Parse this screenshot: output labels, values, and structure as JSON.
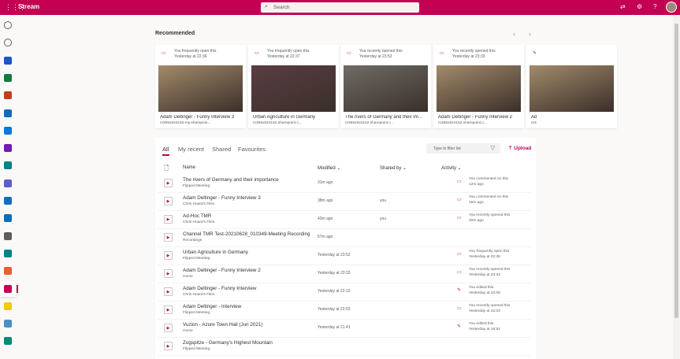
{
  "header": {
    "app": "Stream",
    "search_placeholder": "Search",
    "icons": [
      "waffle-icon",
      "whats-new-icon",
      "settings-icon",
      "help-icon",
      "avatar"
    ]
  },
  "colors": {
    "brand": "#c30052"
  },
  "sidebar": {
    "items": [
      {
        "name": "home",
        "color": "#605e5c"
      },
      {
        "name": "create",
        "color": "#605e5c"
      },
      {
        "name": "word",
        "color": "#185abd"
      },
      {
        "name": "excel",
        "color": "#107c41"
      },
      {
        "name": "powerpoint",
        "color": "#c43e1c"
      },
      {
        "name": "outlook",
        "color": "#0f6cbd"
      },
      {
        "name": "onedrive",
        "color": "#0f78d4"
      },
      {
        "name": "onenote",
        "color": "#7719aa"
      },
      {
        "name": "sharepoint",
        "color": "#038387"
      },
      {
        "name": "teams",
        "color": "#5b5fc7"
      },
      {
        "name": "yammer",
        "color": "#106ebe"
      },
      {
        "name": "power-automate",
        "color": "#0f6cbd"
      },
      {
        "name": "exchange",
        "color": "#605e5c"
      },
      {
        "name": "sway",
        "color": "#038387"
      },
      {
        "name": "forms-orange",
        "color": "#e8602b"
      },
      {
        "name": "stream",
        "color": "#c30052"
      },
      {
        "name": "power-bi",
        "color": "#f2c811"
      },
      {
        "name": "kaizala",
        "color": "#4a90c2"
      },
      {
        "name": "bookings",
        "color": "#0a8a76"
      }
    ]
  },
  "recommended": {
    "title": "Recommended",
    "cards": [
      {
        "activity": "You frequently open this",
        "time": "Yesterday at 22:36",
        "title": "Adam Deltinger - Funny Interview 3",
        "url": "m365x924162-my.sharepoin...",
        "thumb": "#a38a6a"
      },
      {
        "activity": "You frequently open this",
        "time": "Yesterday at 22:37",
        "title": "Urban Agriculture in Germany",
        "url": "m365x924162.sharepoint.c...",
        "thumb": "#5a3d42"
      },
      {
        "activity": "You recently opened this",
        "time": "Yesterday at 23:53",
        "title": "The rivers of Germany and their im...",
        "url": "m365x924162.sharepoint.c...",
        "thumb": "#6f6c66"
      },
      {
        "activity": "You recently opened this",
        "time": "Yesterday at 23:33",
        "title": "Adam Deltinger - Funny Interview 2",
        "url": "m365x924162.sharepoint.c...",
        "thumb": "#a38a6a"
      },
      {
        "activity": "",
        "time": "",
        "title": "Ad",
        "url": "m3",
        "thumb": "#a38a6a"
      }
    ]
  },
  "list": {
    "tabs": [
      "All",
      "My recent",
      "Shared",
      "Favourites"
    ],
    "filter_placeholder": "Type to filter list",
    "upload": "Upload",
    "columns": {
      "name": "Name",
      "modified": "Modified",
      "shared": "Shared by",
      "activity": "Activity"
    },
    "rows": [
      {
        "name": "The rivers of Germany and their importance",
        "loc": "Flipped Meeting",
        "modified": "31m ago",
        "shared": "",
        "icon": "comment-icon",
        "a1": "You commented on this",
        "a2": "12m ago"
      },
      {
        "name": "Adam Deltinger - Funny Interview 3",
        "loc": "Chris Hoard's Files",
        "modified": "38m ago",
        "shared": "you",
        "icon": "comment-icon",
        "a1": "You commented on this",
        "a2": "15m ago"
      },
      {
        "name": "Ad-Hoc TMR",
        "loc": "Chris Hoard's Files",
        "modified": "43m ago",
        "shared": "you",
        "icon": "opened-icon",
        "a1": "You recently opened this",
        "a2": "20m ago"
      },
      {
        "name": "Channel TMR Test-20210628_010349-Meeting Recording",
        "loc": "Recordings",
        "modified": "57m ago",
        "shared": "",
        "icon": "",
        "a1": "",
        "a2": ""
      },
      {
        "name": "Urban Agriculture in Germany",
        "loc": "Flipped Meeting",
        "modified": "Yesterday at 23:52",
        "shared": "",
        "icon": "opened-icon",
        "a1": "You frequently open this",
        "a2": "Yesterday at 22:36"
      },
      {
        "name": "Adam Deltinger - Funny Interview 2",
        "loc": "Home",
        "modified": "Yesterday at 23:33",
        "shared": "",
        "icon": "opened-icon",
        "a1": "You recently opened this",
        "a2": "Yesterday at 23:33"
      },
      {
        "name": "Adam Deltinger - Funny Interview",
        "loc": "Chris Hoard's Files",
        "modified": "Yesterday at 22:10",
        "shared": "",
        "icon": "edit-icon",
        "a1": "You edited this",
        "a2": "Yesterday at 22:09"
      },
      {
        "name": "Adam Deltinger - Interview",
        "loc": "Flipped Meeting",
        "modified": "Yesterday at 22:03",
        "shared": "",
        "icon": "opened-icon",
        "a1": "You recently opened this",
        "a2": "Yesterday at 22:03"
      },
      {
        "name": "Vuzion - Azure Town Hall (Jun 2021)",
        "loc": "Home",
        "modified": "Yesterday at 21:41",
        "shared": "",
        "icon": "edit-icon",
        "a1": "You edited this",
        "a2": "Yesterday at 16:51"
      },
      {
        "name": "Zugspitze - Germany's Highest Mountain",
        "loc": "Flipped Meeting",
        "modified": "",
        "shared": "",
        "icon": "",
        "a1": "",
        "a2": ""
      }
    ]
  }
}
